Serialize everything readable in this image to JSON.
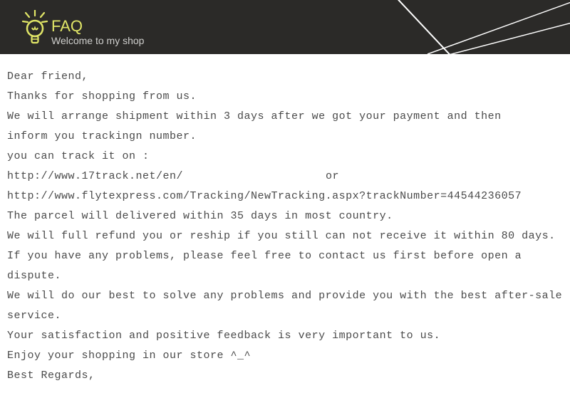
{
  "header": {
    "title": "FAQ",
    "subtitle": "Welcome to my shop"
  },
  "body": {
    "lines": [
      "Dear friend,",
      "Thanks for shopping from us.",
      "We will arrange shipment within 3 days after we got your payment and then",
      "inform you trackingn number.",
      "you can track it on :",
      "",
      "http://www.flytexpress.com/Tracking/NewTracking.aspx?trackNumber=44544236057",
      "The parcel will delivered within 35 days in most country.",
      "We will full refund you or reship if you still can not receive it within 80 days.",
      "If you have any problems, please feel free to contact us first before open a dispute.",
      "We will do our best to solve any problems and provide you with the best after-sale",
      "service.",
      "Your satisfaction and positive feedback is very important to us.",
      "Enjoy your shopping in our store ^_^",
      "Best Regards,"
    ],
    "track_line": {
      "url": "http://www.17track.net/en/",
      "or": "or"
    }
  }
}
